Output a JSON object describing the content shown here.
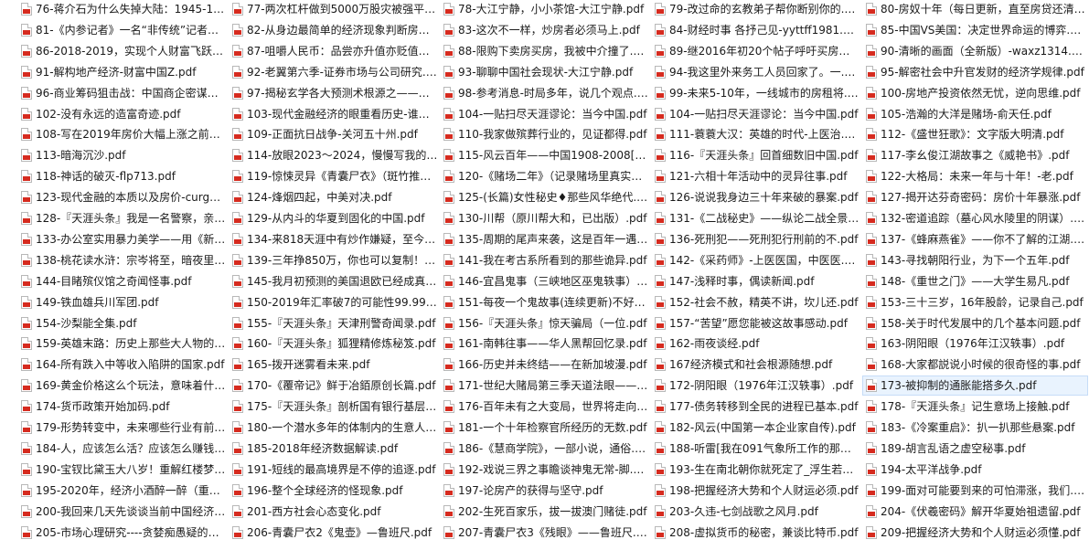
{
  "columns": [
    {
      "files": [
        "76-蒋介石为什么失掉大陆：1945-1949.pdf",
        "81-《内参记者》一名“非传统”记者的自述.pdf",
        "86-2018-2019，实现个人财富飞跃的经济.pdf",
        "91-解构地产经济-财富中国Z.pdf",
        "96-商业筹码狙击战：中国商企密谋战略.pdf",
        "102-没有永远的造富奇迹.pdf",
        "108-写在2019年房价大幅上涨之前的话.pdf",
        "113-暗海沉沙.pdf",
        "118-神话的破灭-flp713.pdf",
        "123-现代金融的本质以及房价-curgoo.pdf",
        "128-『天涯头条』我是一名警察，亲历的那些案.pdf",
        "133-办公室实用暴力美学——用《新三国》.pdf",
        "138-桃花读水浒：宗岑将至，暗夜里的.pdf",
        "144-目睹殡仪馆之奇闻怪事.pdf",
        "149-铁血雄兵川军团.pdf",
        "154-沙梨能全集.pdf",
        "159-英雄末路：历史上那些大人物的死.pdf",
        "164-所有跌入中等收入陷阱的国家.pdf",
        "169-黄金价格这么个玩法，意味着什么.pdf",
        "174-货币政策开始加码.pdf",
        "179-形势转变中，未来哪些行业有前途.pdf",
        "184-人，应该怎么活？应该怎么赚钱.pdf",
        "190-宝钗比黛玉大八岁！重解红楼梦.pdf",
        "195-2020年，经济小酒醉一醉（重启版）.pdf",
        "200-我回来几天先谈谈当前中国经济形势.pdf",
        "205-市场心理研究----贪婪痴愚疑的经济学.pdf"
      ]
    },
    {
      "files": [
        "77-两次杠杆做到5000万股灾被强平的.pdf",
        "82-从身边最简单的经济现象判断房价.pdf",
        "87-咀嚼人民币：品尝亦升值亦贬值的.pdf",
        "92-老翼第六季-证券市场与公司研究.pdf",
        "97-揭秘玄学各大预测术根源之——易经.pdf",
        "103-现代金融经济的眼重看历史-谁在.pdf",
        "109-正面抗日战争-关河五十州.pdf",
        "114-放眼2023～2024，慢慢写我的.pdf",
        "119-惊悚灵异《青囊尸衣》（斑竹推荐）.pdf",
        "124-烽烟四起，中美对决.pdf",
        "129-从内斗的华夏到固化的中国.pdf",
        "134-来818天涯中有炒作嫌疑，至今.pdf",
        "139-三年挣850万，你也可以复制！.pdf",
        "145-我月初预测的美国退欧已经成真.pdf",
        "150-2019年汇率破7的可能性99.99%.pdf",
        "155-『天涯头条』天津刑警奇闻录.pdf",
        "160-『天涯头条』狐狸精修炼秘笈.pdf",
        "165-拨开迷雾看未来.pdf",
        "170-《覆帝记》鲜于冶銆原创长篇.pdf",
        "175-『天涯头条』剖析国有银行基层.pdf",
        "180-一个潜水多年的体制内的生意人.pdf",
        "185-2018年经济数据解读.pdf",
        "191-短线的最高境界是不停的追逐.pdf",
        "196-整个全球经济的怪现象.pdf",
        "201-西方社会心态变化.pdf",
        "206-青囊尸衣2《鬼壶》—鲁班尺.pdf"
      ]
    },
    {
      "files": [
        "78-大江宁静，小小茶馆-大江宁静.pdf",
        "83-这次不一样，炒房者必须马上.pdf",
        "88-限购下卖房买房，我被中介撞了.pdf",
        "93-聊聊中国社会现状-大江宁静.pdf",
        "98-参考消息-时局多年，说几个观点.pdf",
        "104-一贴扫尽天涯谬论：当今中国.pdf",
        "110-我家做殡葬行业的，见证都得.pdf",
        "115-风云百年——中国1908-2008[整理版].pdf",
        "120-《赌场二年》（记录赌场里真实的.pdf",
        "125-(长篇)女性秘史♦那些风华绝代.pdf",
        "130-川帮（原川帮大和，已出版）.pdf",
        "135-周期的尾声来袭，这是百年一遇.pdf",
        "141-我在考古系所看到的那些诡异.pdf",
        "146-宜昌鬼事（三峡地区巫鬼轶事）.pdf",
        "151-每夜一个鬼故事(连续更新)不好看.pdf",
        "156-『天涯头条』惊天骗局（一位.pdf",
        "161-南韩往事——华人黑帮回忆录.pdf",
        "166-历史并未终结——在新加坡漫.pdf",
        "171-世纪大赌局第三季天道法眼——.pdf",
        "176-百年未有之大变局，世界将走向.pdf",
        "181-一个十年检察官所经历的无数.pdf",
        "186-《慧商学院》，一部小说，通俗.pdf",
        "192-戏说三界之事瞻谈神鬼无常-脚.pdf",
        "197-论房产的获得与坚守.pdf",
        "202-生死百家乐，拔一拔澳门赌徒.pdf",
        "207-青囊尸衣3《残眼》——鲁班尺.pdf"
      ]
    },
    {
      "files": [
        "79-改过命的玄教弟子帮你断别你的.pdf",
        "84-财经时事 各抒己见-yyttff1981.pdf",
        "89-继2016年初20个帖子呼吁买房正确.pdf",
        "94-我这里外来务工人员回家了。一.pdf",
        "99-未来5-10年，一线城市的房租将.pdf",
        "104-一贴扫尽天涯谬论：当今中国.pdf",
        "111-蓑蓑大汉：英雄的时代-上医治.pdf",
        "116-『天涯头条』回首细数旧中国.pdf",
        "121-六相十年活动中的灵异往事.pdf",
        "126-说说我身边三十年来破的暴案.pdf",
        "131-《二战秘史》——纵论二战全景.pdf",
        "136-死刑犯——死刑犯行刑前的不.pdf",
        "142-《采药师》-上医医国，中医医.pdf",
        "147-浅释时事，偶读新闻.pdf",
        "152-社会不赦，精英不讲，坎儿还.pdf",
        "157-“苦望”愿您能被这故事感动.pdf",
        "162-雨夜谈经.pdf",
        "167经济模式和社会根源随想.pdf",
        "172-阴阳眼（1976年江汉轶事）.pdf",
        "177-债务转移到全民的进程已基本.pdf",
        "182-风云(中国第一本企业家自传).pdf",
        "188-听雷[我在091气象所工作的那些年].pdf",
        "193-生在南北朝你就死定了_浮生若梦.pdf",
        "198-把握经济大势和个人财运必须.pdf",
        "203-久违-七剑战歌之风月.pdf",
        "208-虚拟货币的秘密，兼谈比特币.pdf"
      ]
    },
    {
      "files": [
        "80-房奴十年（每日更新，直至房贷还清）.pdf",
        "85-中国VS美国：决定世界命运的博弈.pdf",
        "90-清晰的画面（全新版）-waxz1314.pdf",
        "95-解密社会中升官发财的经济学规律.pdf",
        "100-房地产投资依然无忧，逆向思维.pdf",
        "105-浩瀚的大洋是赌场-俞天任.pdf",
        "112-《盛世狂歌》：文字版大明清.pdf",
        "117-李幺俊江湖故事之《威艳书》.pdf",
        "122-大格局：未来一年与十年！-老.pdf",
        "127-揭开达芬奇密码：房价十年暴涨.pdf",
        "132-密道追踪（墓心风水陵里的阴谋）.pdf",
        "137-《蜂麻燕雀》——你不了解的江湖.pdf",
        "143-寻找朝阳行业，为下一个五年.pdf",
        "148-《重世之门》——大学生易凡.pdf",
        "153-三十三岁，16年股龄，记录自己.pdf",
        "158-关于时代发展中的几个基本问题.pdf",
        "163-阴阳眼（1976年江汉轶事）.pdf",
        "168-大家都説说小时候的很奇怪的事.pdf",
        "173-被抑制的通胀能搭多久.pdf",
        "178-『天涯头条』记生意场上接触.pdf",
        "183-《冷案重启》：扒一扒那些悬案.pdf",
        "189-胡言乱语之虚空秘事.pdf",
        "194-太平洋战争.pdf",
        "199-面对可能要到来的可怕滞涨，我们.pdf",
        "204-《伏羲密码》解开华夏始祖遗留.pdf",
        "209-把握经济大势和个人财运必须懂.pdf"
      ]
    }
  ]
}
